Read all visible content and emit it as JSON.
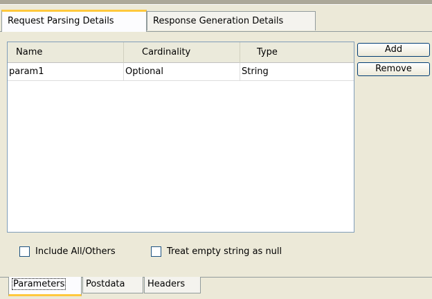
{
  "top_tabs": [
    {
      "label": "Request Parsing Details",
      "active": true
    },
    {
      "label": "Response Generation Details",
      "active": false
    }
  ],
  "table": {
    "columns": [
      "Name",
      "Cardinality",
      "Type"
    ],
    "rows": [
      [
        "param1",
        "Optional",
        "String"
      ]
    ]
  },
  "buttons": {
    "add": "Add",
    "remove": "Remove"
  },
  "checkboxes": [
    {
      "label": "Include All/Others",
      "checked": false
    },
    {
      "label": "Treat empty string as null",
      "checked": false
    }
  ],
  "bottom_tabs": [
    {
      "label": "Parameters",
      "active": true
    },
    {
      "label": "Postdata",
      "active": false
    },
    {
      "label": "Headers",
      "active": false
    }
  ],
  "colors": {
    "active_tab_accent": "#ffc83c",
    "window_bg": "#ece9d8",
    "table_border": "#7f9db9"
  }
}
